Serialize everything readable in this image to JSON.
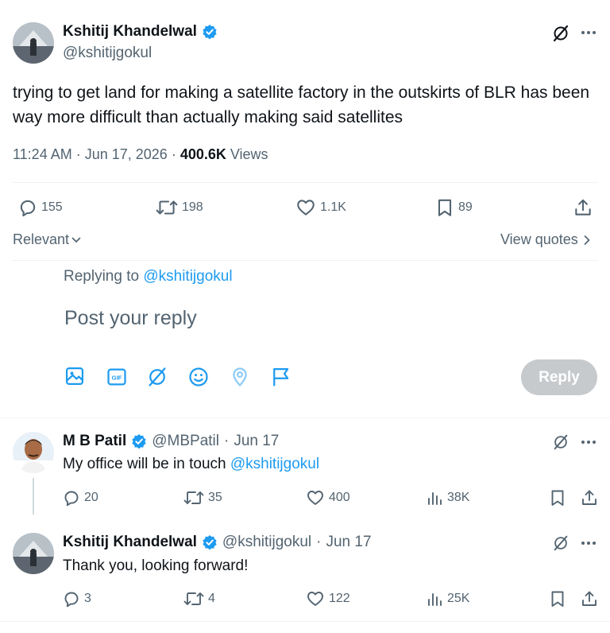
{
  "main_tweet": {
    "author_name": "Kshitij Khandelwal",
    "author_handle": "@kshitijgokul",
    "text": "trying to get land for making a satellite factory in the outskirts of BLR has been way more difficult than actually making said satellites",
    "time": "11:24 AM",
    "date": "Jun 17, 2026",
    "views_count": "400.6K",
    "views_label": "Views",
    "replies": "155",
    "retweets": "198",
    "likes": "1.1K",
    "bookmarks": "89"
  },
  "sort": {
    "label": "Relevant",
    "view_quotes": "View quotes"
  },
  "composer": {
    "replying_prefix": "Replying to",
    "replying_handle": "@kshitijgokul",
    "placeholder": "Post your reply",
    "reply_button": "Reply"
  },
  "replies": [
    {
      "author_name": "M B Patil",
      "author_handle": "@MBPatil",
      "date": "Jun 17",
      "text": "My office will be in touch",
      "mention": "@kshitijgokul",
      "replies": "20",
      "retweets": "35",
      "likes": "400",
      "views": "38K"
    },
    {
      "author_name": "Kshitij Khandelwal",
      "author_handle": "@kshitijgokul",
      "date": "Jun 17",
      "text": "Thank you, looking forward!",
      "replies": "3",
      "retweets": "4",
      "likes": "122",
      "views": "25K"
    }
  ],
  "colors": {
    "accent": "#1d9bf0",
    "muted": "#536471",
    "reply_button_disabled": "#a9a9a9"
  }
}
